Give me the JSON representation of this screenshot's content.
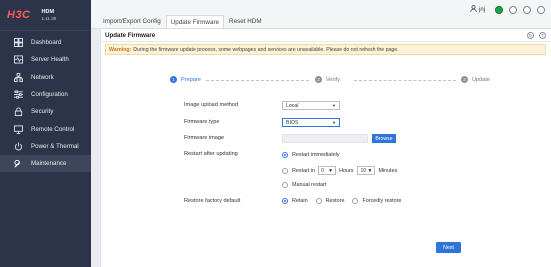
{
  "brand": {
    "logo": "H3C",
    "product": "HDM",
    "version": "1.11.30"
  },
  "sidebar": {
    "items": [
      {
        "label": "Dashboard",
        "icon": "dashboard-icon"
      },
      {
        "label": "Server Health",
        "icon": "heartbeat-icon"
      },
      {
        "label": "Network",
        "icon": "network-icon"
      },
      {
        "label": "Configuration",
        "icon": "sliders-icon"
      },
      {
        "label": "Security",
        "icon": "lock-icon"
      },
      {
        "label": "Remote Control",
        "icon": "monitor-icon"
      },
      {
        "label": "Power & Thermal",
        "icon": "power-icon"
      },
      {
        "label": "Maintenance",
        "icon": "wrench-icon"
      }
    ],
    "active_index": 7
  },
  "tabs": [
    {
      "label": "Import/Export Config"
    },
    {
      "label": "Update Firmware"
    },
    {
      "label": "Reset HDM"
    }
  ],
  "active_tab": 1,
  "header": {
    "username": "jnj"
  },
  "panel": {
    "title": "Update Firmware",
    "warning_label": "Warning:",
    "warning_text": "During the firmware update process, some webpages and services are unavailable. Please do not refresh the page."
  },
  "steps": [
    {
      "num": "1",
      "label": "Prepare"
    },
    {
      "num": "2",
      "label": "Verify"
    },
    {
      "num": "3",
      "label": "Update"
    }
  ],
  "active_step": 0,
  "form": {
    "upload_method_label": "Image upload method",
    "upload_method_value": "Local",
    "firmware_type_label": "Firmware type",
    "firmware_type_value": "BIOS",
    "firmware_image_label": "Firmware image",
    "browse_label": "Browse",
    "restart_label": "Restart after updating",
    "restart_immediately": "Restart immediately",
    "restart_in": "Restart in",
    "restart_hours_value": "0",
    "hours_label": "Hours",
    "restart_minutes_value": "10",
    "minutes_label": "Minutes",
    "manual_restart": "Manual restart",
    "restore_label": "Restore factory default",
    "restore_retain": "Retain",
    "restore_restore": "Restore",
    "restore_forced": "Forcedly restore",
    "next_label": "Next"
  },
  "colors": {
    "accent": "#2f74d8",
    "sidebar": "#2b3448",
    "status_ok": "#1aa34a"
  }
}
